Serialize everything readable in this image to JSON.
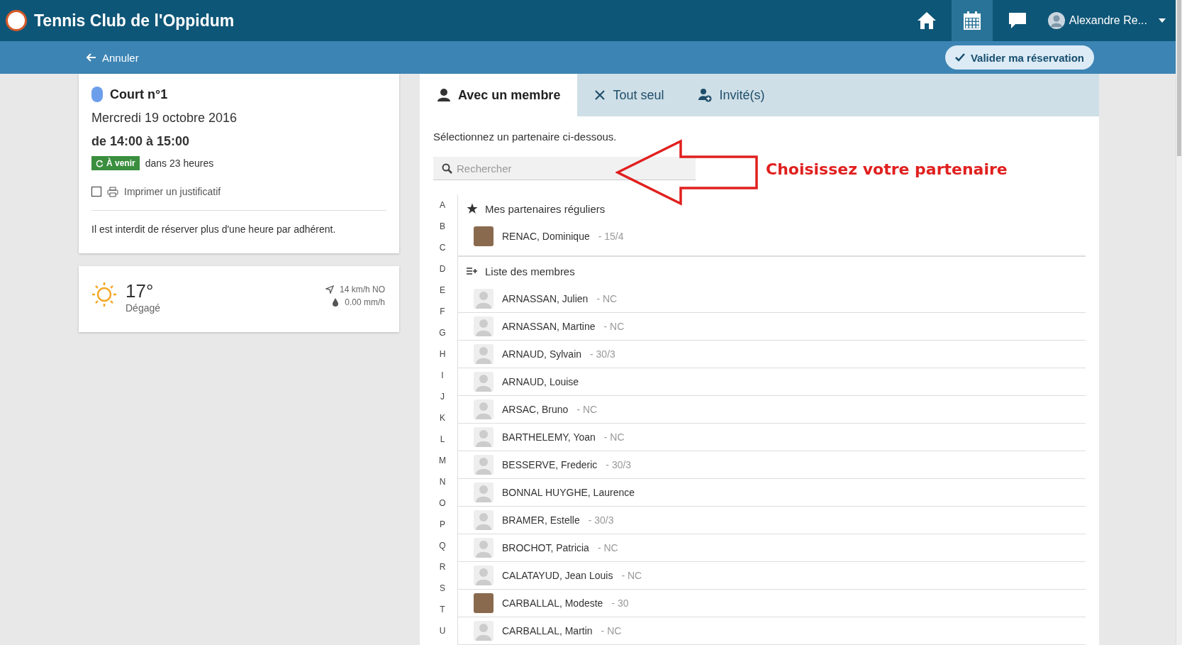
{
  "header": {
    "title": "Tennis Club de l'Oppidum",
    "nav": [
      {
        "kind": "home",
        "selected": false
      },
      {
        "kind": "calendar",
        "selected": true
      },
      {
        "kind": "chat",
        "selected": false
      }
    ],
    "user": "Alexandre Re..."
  },
  "subbar": {
    "back": "Annuler",
    "confirm": "Valider ma réservation"
  },
  "booking": {
    "court": "Court n°1",
    "color": "#6d9eeb",
    "date": "Mercredi 19 octobre 2016",
    "time": "de 14:00 à 15:00",
    "status": "À venir",
    "when": "dans 23 heures",
    "print": {
      "label": "Imprimer un justificatif",
      "checked": false
    },
    "note": "Il est interdit de réserver plus d'une heure par adhérent."
  },
  "weather": {
    "temperature": "17°",
    "condition": "Dégagé",
    "wind": "14 km/h NO",
    "rain": "0.00 mm/h"
  },
  "tabs": [
    {
      "kind": "member",
      "label": "Avec un membre",
      "selected": true
    },
    {
      "kind": "alone",
      "label": "Tout seul",
      "selected": false
    },
    {
      "kind": "guest",
      "label": "Invité(s)",
      "selected": false
    }
  ],
  "prompt": "Sélectionnez un partenaire ci-dessous.",
  "search": {
    "placeholder": "Rechercher"
  },
  "annotation": {
    "text": "Choisissez votre partenaire"
  },
  "letters": [
    "A",
    "B",
    "C",
    "D",
    "E",
    "F",
    "G",
    "H",
    "I",
    "J",
    "K",
    "L",
    "M",
    "N",
    "O",
    "P",
    "Q",
    "R",
    "S",
    "T",
    "U"
  ],
  "regulars": {
    "title": "Mes partenaires réguliers",
    "members": [
      {
        "name": "RENAC, Dominique",
        "rank": "- 15/4",
        "kind": "photo"
      }
    ]
  },
  "members": {
    "title": "Liste des membres",
    "items": [
      {
        "name": "ARNASSAN, Julien",
        "rank": "- NC",
        "kind": "silhouette"
      },
      {
        "name": "ARNASSAN, Martine",
        "rank": "- NC",
        "kind": "silhouette"
      },
      {
        "name": "ARNAUD, Sylvain",
        "rank": "- 30/3",
        "kind": "silhouette"
      },
      {
        "name": "ARNAUD, Louise",
        "kind": "silhouette"
      },
      {
        "name": "ARSAC, Bruno",
        "rank": "- NC",
        "kind": "silhouette"
      },
      {
        "name": "BARTHELEMY, Yoan",
        "rank": "- NC",
        "kind": "silhouette"
      },
      {
        "name": "BESSERVE, Frederic",
        "rank": "- 30/3",
        "kind": "silhouette"
      },
      {
        "name": "BONNAL HUYGHE, Laurence",
        "kind": "silhouette"
      },
      {
        "name": "BRAMER, Estelle",
        "rank": "- 30/3",
        "kind": "silhouette"
      },
      {
        "name": "BROCHOT, Patricia",
        "rank": "- NC",
        "kind": "silhouette"
      },
      {
        "name": "CALATAYUD, Jean Louis",
        "rank": "- NC",
        "kind": "silhouette"
      },
      {
        "name": "CARBALLAL, Modeste",
        "rank": "- 30",
        "kind": "photo"
      },
      {
        "name": "CARBALLAL, Martin",
        "rank": "- NC",
        "kind": "silhouette"
      }
    ]
  }
}
